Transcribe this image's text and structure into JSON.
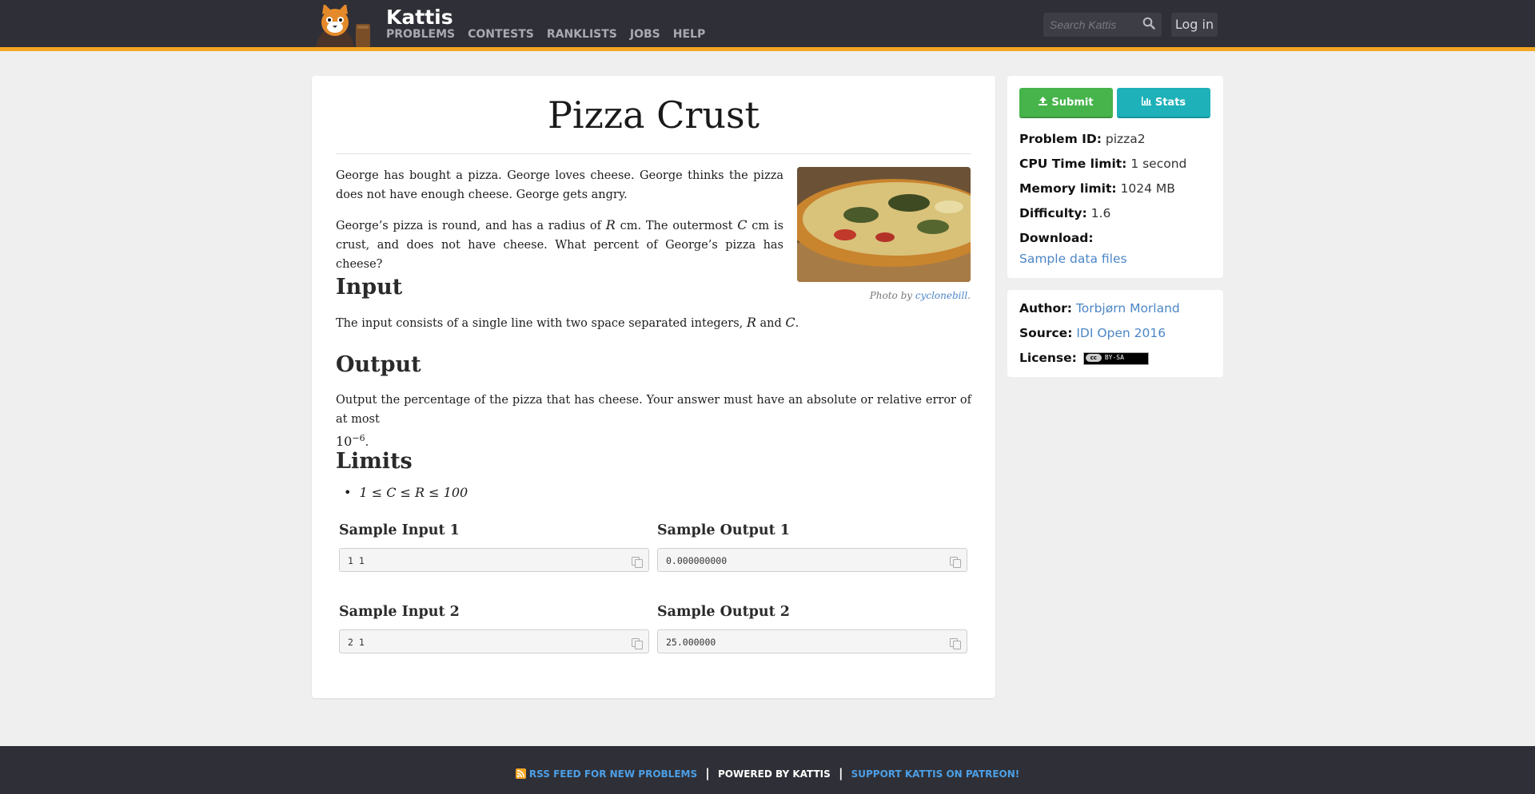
{
  "header": {
    "brand": "Kattis",
    "nav": [
      "PROBLEMS",
      "CONTESTS",
      "RANKLISTS",
      "JOBS",
      "HELP"
    ],
    "search_placeholder": "Search Kattis",
    "login_label": "Log in"
  },
  "problem": {
    "title": "Pizza Crust",
    "intro_p1": "George has bought a pizza. George loves cheese. George thinks the pizza does not have enough cheese. George gets angry.",
    "intro_p2_a": "George’s pizza is round, and has a radius of ",
    "var_R": "R",
    "intro_p2_b": " cm. The outermost ",
    "var_C": "C",
    "intro_p2_c": " cm is crust, and does not have cheese. What percent of George’s pizza has cheese?",
    "photo_caption_prefix": "Photo by ",
    "photo_caption_author": "cyclonebill",
    "photo_caption_suffix": ".",
    "input_heading": "Input",
    "input_text_a": "The input consists of a single line with two space separated integers, ",
    "input_text_and": " and ",
    "input_text_end": ".",
    "output_heading": "Output",
    "output_text": "Output the percentage of the pizza that has cheese. Your answer must have an absolute or relative error of at most",
    "output_math_base": "10",
    "output_math_exp": "−6",
    "output_end": ".",
    "limits_heading": "Limits",
    "limit_item": "1 ≤ C ≤ R ≤ 100",
    "samples": [
      {
        "input_label": "Sample Input 1",
        "input": "1 1",
        "output_label": "Sample Output 1",
        "output": "0.000000000"
      },
      {
        "input_label": "Sample Input 2",
        "input": "2 1",
        "output_label": "Sample Output 2",
        "output": "25.000000"
      }
    ]
  },
  "sidebar": {
    "submit_label": "Submit",
    "stats_label": "Stats",
    "problem_id_key": "Problem ID:",
    "problem_id": "pizza2",
    "cpu_key": "CPU Time limit:",
    "cpu": "1 second",
    "memory_key": "Memory limit:",
    "memory": "1024 MB",
    "difficulty_key": "Difficulty:",
    "difficulty": "1.6",
    "download_key": "Download:",
    "download_link": "Sample data files",
    "author_key": "Author:",
    "author": "Torbjørn Morland",
    "source_key": "Source:",
    "source": "IDI Open 2016",
    "license_key": "License:",
    "license_badge_left": "cc",
    "license_badge": "BY-SA"
  },
  "footer": {
    "rss": "RSS FEED FOR NEW PROBLEMS",
    "powered": "POWERED BY KATTIS",
    "patreon": "SUPPORT KATTIS ON PATREON!"
  },
  "colors": {
    "header_bg": "#2f3037",
    "accent": "#f4a623",
    "submit": "#46b44b",
    "stats": "#1eb1b9",
    "link": "#4c86c6"
  }
}
